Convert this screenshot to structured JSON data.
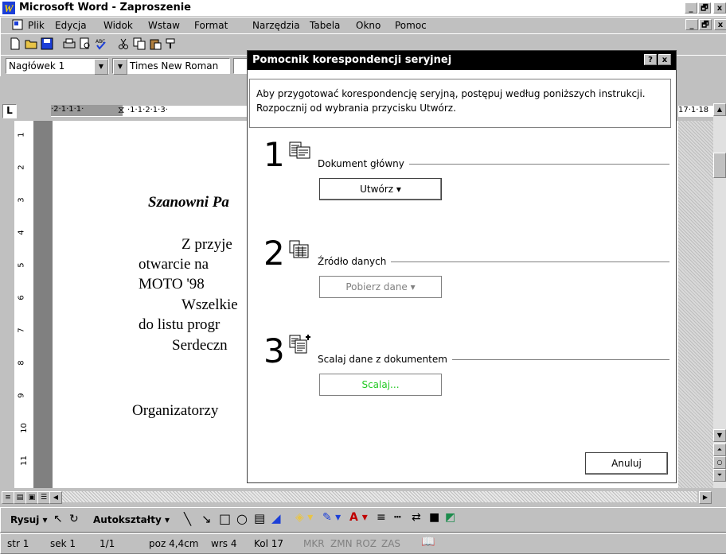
{
  "window": {
    "title": "Microsoft Word - Zaproszenie",
    "controls": [
      "_",
      "🗗",
      "x"
    ]
  },
  "menubar": {
    "items": [
      "Plik",
      "Edycja",
      "Widok",
      "Wstaw",
      "Format",
      "Narzędzia",
      "Tabela",
      "Okno",
      "Pomoc"
    ],
    "doc_controls": [
      "_",
      "🗗",
      "x"
    ]
  },
  "formatting": {
    "style": "Nagłówek 1",
    "font": "Times New Roman"
  },
  "ruler": {
    "tab_indicator": "L",
    "left_ticks": "·2·1·1·1·",
    "right_ticks": "·1·1·2·1·3·",
    "far_right_ticks": "17·1·18"
  },
  "document": {
    "lines": [
      "Szanowni Pa",
      "Z  przyje",
      "otwarcie  na",
      "MOTO '98",
      "Wszelkie",
      "do listu progr",
      "Serdeczn",
      "Organizatorzy"
    ],
    "vruler_numbers": [
      "1",
      "2",
      "3",
      "4",
      "5",
      "6",
      "7",
      "8",
      "9",
      "10",
      "11"
    ]
  },
  "drawing_toolbar": {
    "draw_label": "Rysuj",
    "autoshapes_label": "Autokształty"
  },
  "status": {
    "page": "str 1",
    "section": "sek 1",
    "pages": "1/1",
    "position": "poz 4,4cm",
    "line": "wrs 4",
    "column": "Kol 17",
    "modes": [
      "MKR",
      "ZMN",
      "ROZ",
      "ZAS"
    ]
  },
  "dialog": {
    "title": "Pomocnik korespondencji seryjnej",
    "help": "?",
    "close": "x",
    "instructions": "Aby przygotować korespondencję seryjną, postępuj według poniższych instrukcji. Rozpocznij od wybrania przycisku Utwórz.",
    "steps": [
      {
        "num": "1",
        "label": "Dokument główny",
        "button": "Utwórz ▾",
        "enabled": true
      },
      {
        "num": "2",
        "label": "Źródło danych",
        "button": "Pobierz dane ▾",
        "enabled": false
      },
      {
        "num": "3",
        "label": "Scalaj dane z dokumentem",
        "button": "Scalaj...",
        "enabled": false
      }
    ],
    "cancel": "Anuluj"
  },
  "colors": {
    "word_icon": "#1c3fd8",
    "dialog_titlebar": "#000000",
    "disabled_text": "#808080",
    "scalaj_text": "#22c922"
  }
}
